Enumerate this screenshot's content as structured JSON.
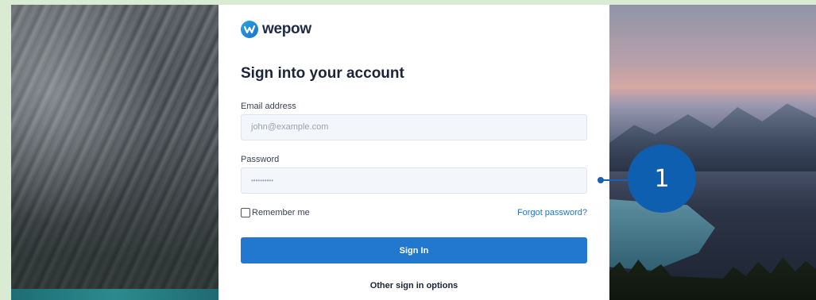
{
  "brand": {
    "name": "wepow",
    "color": "#1f2a44",
    "mark_color": "#1a6fd1"
  },
  "form": {
    "title": "Sign into your account",
    "email_label": "Email address",
    "email_placeholder": "john@example.com",
    "password_label": "Password",
    "password_value": "••••••••••",
    "remember_label": "Remember me",
    "forgot_label": "Forgot password?",
    "signin_label": "Sign In",
    "other_options_label": "Other sign in options"
  },
  "colors": {
    "accent": "#2277cf",
    "callout": "#0f5fb0"
  },
  "callout": {
    "number": "1"
  }
}
